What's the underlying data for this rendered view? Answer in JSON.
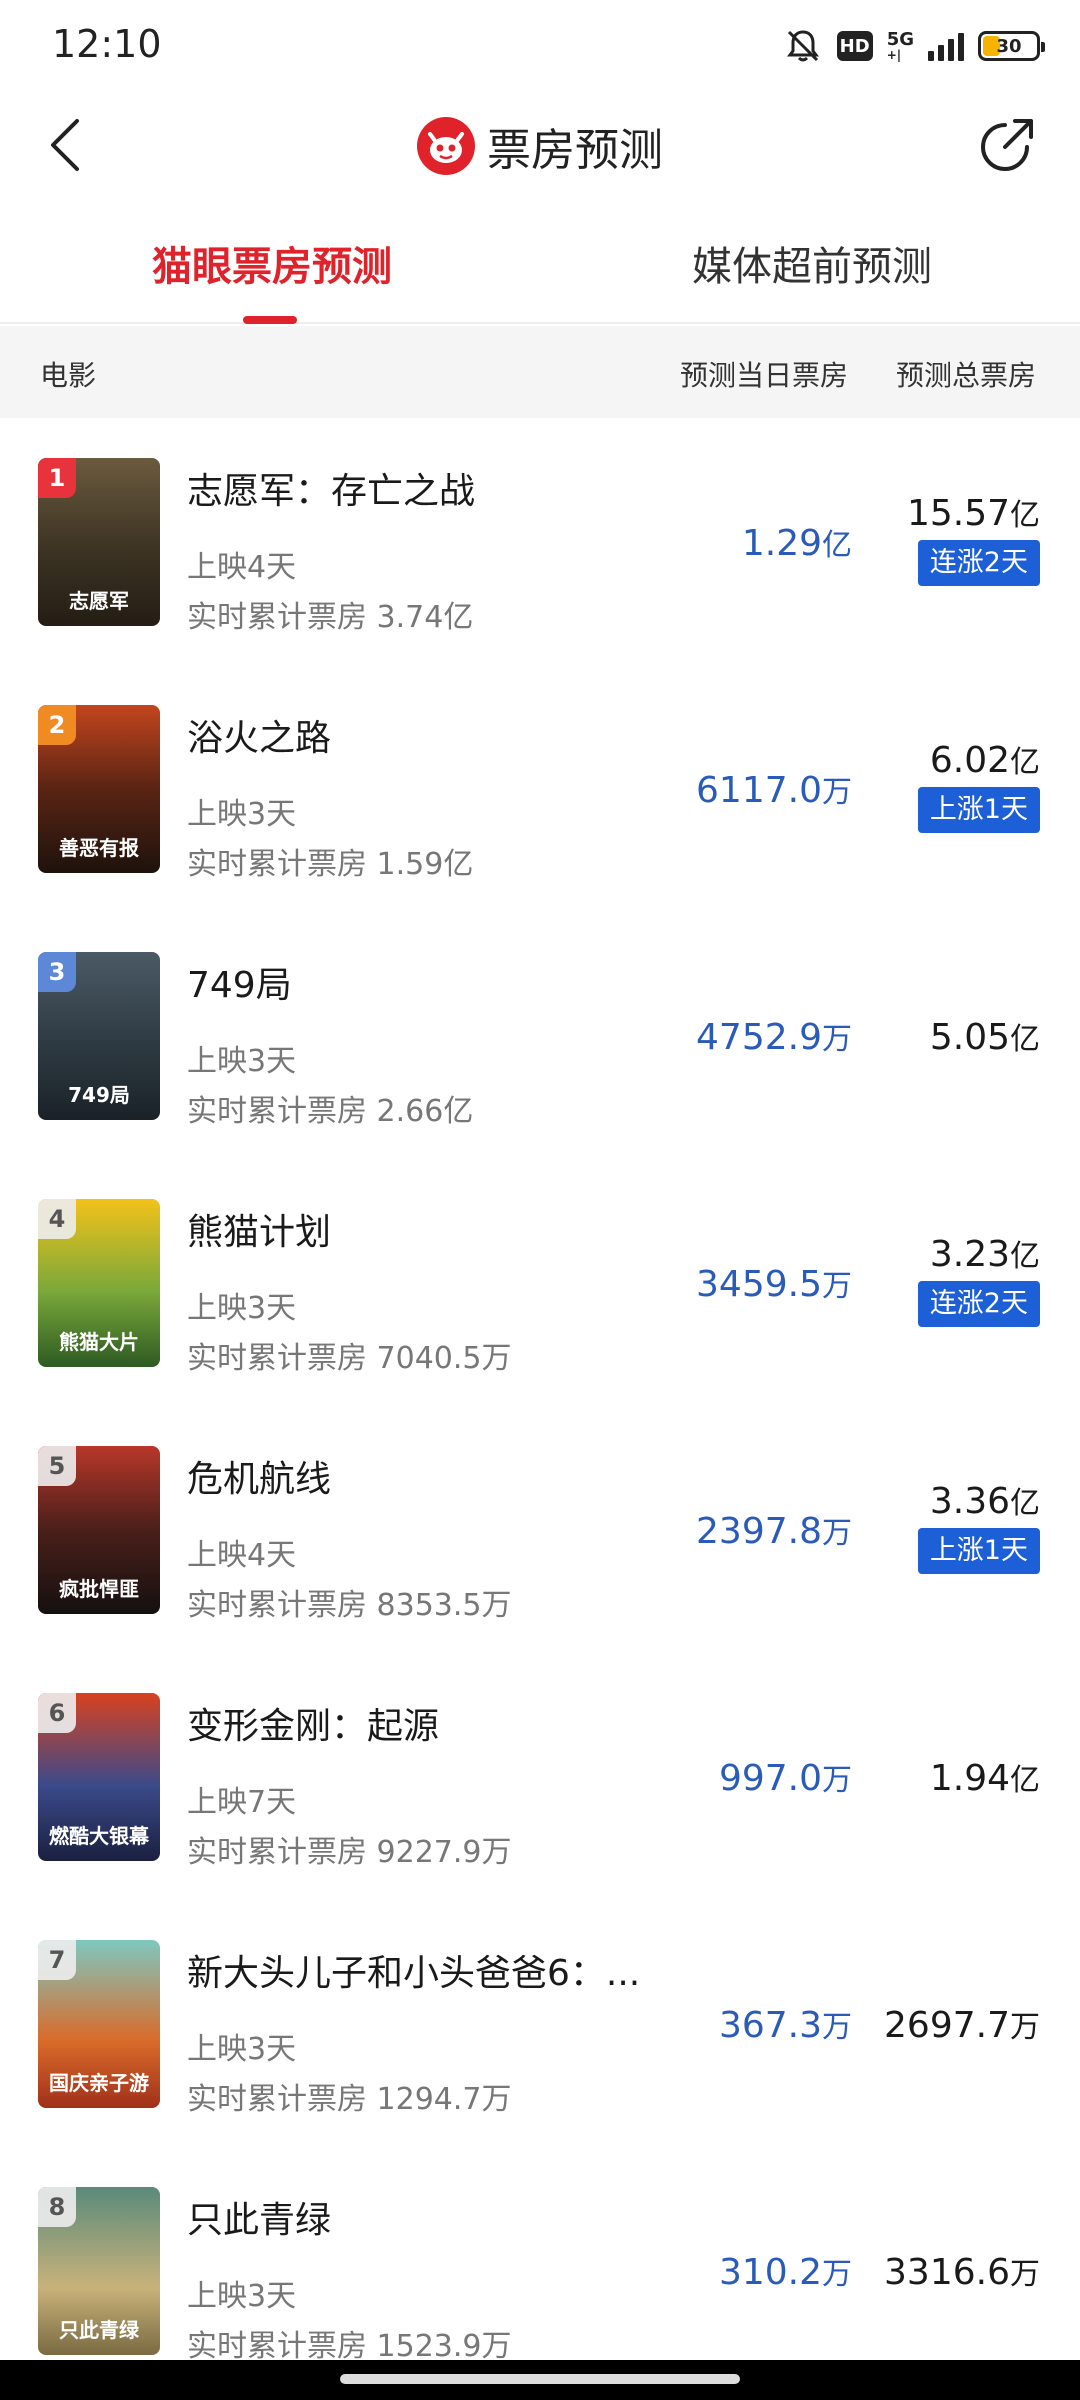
{
  "status_bar": {
    "time": "12:10",
    "icons": [
      "bell-muted-icon",
      "hd-icon",
      "5g-signal-icon",
      "battery-icon"
    ],
    "hd_label": "HD",
    "network_label": "5G",
    "network_sub": "+|",
    "battery_level": "30"
  },
  "header": {
    "title": "票房预测",
    "back_icon": "chevron-left-icon",
    "share_icon": "share-icon",
    "logo_icon": "maoyan-cat-logo"
  },
  "tabs": [
    {
      "label": "猫眼票房预测",
      "active": true
    },
    {
      "label": "媒体超前预测",
      "active": false
    }
  ],
  "columns": {
    "movie": "电影",
    "daily": "预测当日票房",
    "total": "预测总票房"
  },
  "colors": {
    "accent": "#e0232b",
    "daily_value": "#2a5bb8",
    "badge_blue": "#1c5fd6"
  },
  "movies": [
    {
      "rank": "1",
      "title": "志愿军：存亡之战",
      "days": "上映4天",
      "cumulative": "实时累计票房 3.74亿",
      "daily_value": "1.29",
      "daily_unit": "亿",
      "total_value": "15.57",
      "total_unit": "亿",
      "badge": "连涨2天",
      "poster_caption": "志愿军"
    },
    {
      "rank": "2",
      "title": "浴火之路",
      "days": "上映3天",
      "cumulative": "实时累计票房 1.59亿",
      "daily_value": "6117.0",
      "daily_unit": "万",
      "total_value": "6.02",
      "total_unit": "亿",
      "badge": "上涨1天",
      "poster_caption": "善恶有报"
    },
    {
      "rank": "3",
      "title": "749局",
      "days": "上映3天",
      "cumulative": "实时累计票房 2.66亿",
      "daily_value": "4752.9",
      "daily_unit": "万",
      "total_value": "5.05",
      "total_unit": "亿",
      "badge": "",
      "poster_caption": "749局"
    },
    {
      "rank": "4",
      "title": "熊猫计划",
      "days": "上映3天",
      "cumulative": "实时累计票房 7040.5万",
      "daily_value": "3459.5",
      "daily_unit": "万",
      "total_value": "3.23",
      "total_unit": "亿",
      "badge": "连涨2天",
      "poster_caption": "熊猫大片"
    },
    {
      "rank": "5",
      "title": "危机航线",
      "days": "上映4天",
      "cumulative": "实时累计票房 8353.5万",
      "daily_value": "2397.8",
      "daily_unit": "万",
      "total_value": "3.36",
      "total_unit": "亿",
      "badge": "上涨1天",
      "poster_caption": "疯批悍匪"
    },
    {
      "rank": "6",
      "title": "变形金刚：起源",
      "days": "上映7天",
      "cumulative": "实时累计票房 9227.9万",
      "daily_value": "997.0",
      "daily_unit": "万",
      "total_value": "1.94",
      "total_unit": "亿",
      "badge": "",
      "poster_caption": "燃酷大银幕"
    },
    {
      "rank": "7",
      "title": "新大头儿子和小头爸爸6：...",
      "days": "上映3天",
      "cumulative": "实时累计票房 1294.7万",
      "daily_value": "367.3",
      "daily_unit": "万",
      "total_value": "2697.7",
      "total_unit": "万",
      "badge": "",
      "poster_caption": "国庆亲子游"
    },
    {
      "rank": "8",
      "title": "只此青绿",
      "days": "上映3天",
      "cumulative": "实时累计票房 1523.9万",
      "daily_value": "310.2",
      "daily_unit": "万",
      "total_value": "3316.6",
      "total_unit": "万",
      "badge": "",
      "poster_caption": "只此青绿"
    }
  ]
}
